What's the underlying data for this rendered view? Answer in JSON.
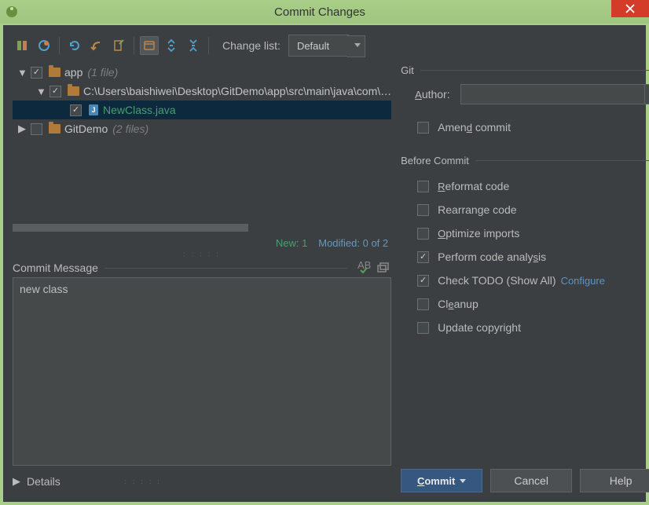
{
  "window": {
    "title": "Commit Changes"
  },
  "toolbar": {
    "changelist_label": "Change list:",
    "changelist_value": "Default"
  },
  "tree": {
    "app": {
      "name": "app",
      "meta": "(1 file)"
    },
    "path": {
      "label": "C:\\Users\\baishiwei\\Desktop\\GitDemo\\app\\src\\main\\java\\com\\…"
    },
    "file": {
      "name": "NewClass.java"
    },
    "gitdemo": {
      "name": "GitDemo",
      "meta": "(2 files)"
    }
  },
  "stats": {
    "new": "New: 1",
    "modified": "Modified: 0 of 2"
  },
  "commit_message": {
    "label": "Commit Message",
    "value": "new class"
  },
  "details": {
    "label": "Details"
  },
  "git": {
    "section": "Git",
    "author_label": "Author:",
    "amend": "Amend commit"
  },
  "before_commit": {
    "section": "Before Commit",
    "reformat": "Reformat code",
    "rearrange": "Rearrange code",
    "optimize": "Optimize imports",
    "analysis": "Perform code analysis",
    "todo": "Check TODO (Show All)",
    "configure": "Configure",
    "cleanup": "Cleanup",
    "copyright": "Update copyright"
  },
  "buttons": {
    "commit": "Commit",
    "cancel": "Cancel",
    "help": "Help"
  }
}
